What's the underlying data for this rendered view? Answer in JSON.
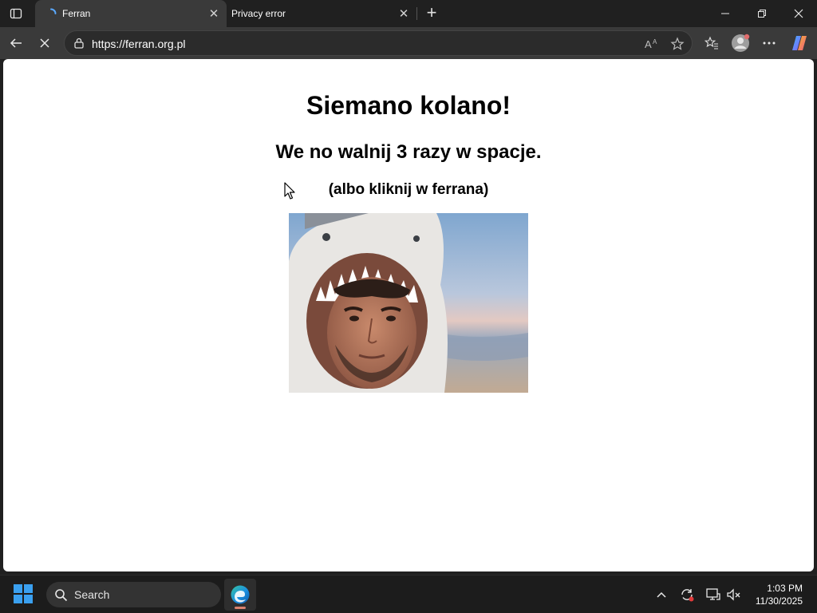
{
  "browser": {
    "tabs": [
      {
        "title": "Ferran",
        "active": true,
        "loading": true
      },
      {
        "title": "Privacy error",
        "active": false
      }
    ],
    "new_tab_symbol": "+",
    "url": "https://ferran.org.pl",
    "window_controls": [
      "minimize-icon",
      "restore-icon",
      "close-icon"
    ],
    "toolbar_icons": [
      "back-icon",
      "stop-loading-icon",
      "lock-icon",
      "read-aloud-icon",
      "favorite-star-icon",
      "favorites-icon",
      "profile-avatar-icon",
      "more-menu-icon",
      "copilot-icon"
    ]
  },
  "page": {
    "heading1": "Siemano kolano!",
    "heading2": "We no walnij 3 razy w spacje.",
    "heading3": "(albo kliknij w ferrana)",
    "image": "person-in-shark-hoodie-photo"
  },
  "taskbar": {
    "search_label": "Search",
    "time": "1:03 PM",
    "date": "11/30/2025",
    "tray_icons": [
      "chevron-up-icon",
      "sync-icon",
      "display-icon",
      "speaker-muted-icon"
    ]
  },
  "colors": {
    "titlebar": "#202020",
    "active_tab": "#3a3a3a",
    "page_bg": "#ffffff",
    "taskbar": "#1c1c1c",
    "windows_blue": "#3aa0f0"
  }
}
